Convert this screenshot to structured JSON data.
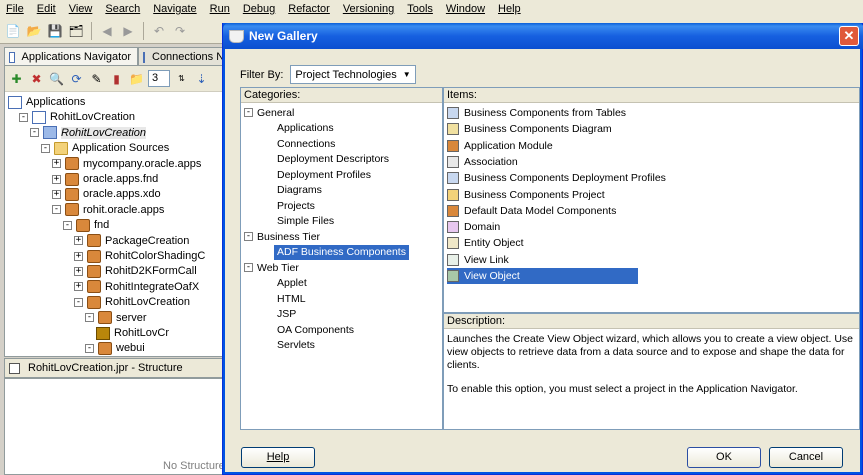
{
  "menu": [
    "File",
    "Edit",
    "View",
    "Search",
    "Navigate",
    "Run",
    "Debug",
    "Refactor",
    "Versioning",
    "Tools",
    "Window",
    "Help"
  ],
  "left": {
    "tabs": [
      "Applications Navigator",
      "Connections N"
    ],
    "spinner_value": "3",
    "tree": [
      {
        "label": "Applications",
        "indent": 0,
        "icon": "app",
        "exp": ""
      },
      {
        "label": "RohitLovCreation",
        "indent": 1,
        "icon": "app",
        "exp": "-"
      },
      {
        "label": "RohitLovCreation",
        "indent": 2,
        "icon": "proj",
        "exp": "-"
      },
      {
        "label": "Application Sources",
        "indent": 3,
        "icon": "folder",
        "exp": "-"
      },
      {
        "label": "mycompany.oracle.apps",
        "indent": 4,
        "icon": "pkg",
        "exp": "+"
      },
      {
        "label": "oracle.apps.fnd",
        "indent": 4,
        "icon": "pkg",
        "exp": "+"
      },
      {
        "label": "oracle.apps.xdo",
        "indent": 4,
        "icon": "pkg",
        "exp": "+"
      },
      {
        "label": "rohit.oracle.apps",
        "indent": 4,
        "icon": "pkg",
        "exp": "-"
      },
      {
        "label": "fnd",
        "indent": 5,
        "icon": "pkg",
        "exp": "-"
      },
      {
        "label": "PackageCreation",
        "indent": 6,
        "icon": "pkg",
        "exp": "+"
      },
      {
        "label": "RohitColorShadingC",
        "indent": 6,
        "icon": "pkg",
        "exp": "+"
      },
      {
        "label": "RohitD2KFormCall",
        "indent": 6,
        "icon": "pkg",
        "exp": "+"
      },
      {
        "label": "RohitIntegrateOafX",
        "indent": 6,
        "icon": "pkg",
        "exp": "+"
      },
      {
        "label": "RohitLovCreation",
        "indent": 6,
        "icon": "pkg",
        "exp": "-"
      },
      {
        "label": "server",
        "indent": 7,
        "icon": "pkg",
        "exp": "-"
      },
      {
        "label": "RohitLovCr",
        "indent": 8,
        "icon": "jar",
        "exp": ""
      },
      {
        "label": "webui",
        "indent": 7,
        "icon": "pkg",
        "exp": "-"
      }
    ],
    "structure_tab": "RohitLovCreation.jpr - Structure",
    "structure_empty": "No Structure"
  },
  "dialog": {
    "title": "New Gallery",
    "filter_label": "Filter By:",
    "filter_value": "Project Technologies",
    "categories_header": "Categories:",
    "categories": [
      {
        "label": "General",
        "level": 0,
        "exp": "-"
      },
      {
        "label": "Applications",
        "level": 1
      },
      {
        "label": "Connections",
        "level": 1
      },
      {
        "label": "Deployment Descriptors",
        "level": 1
      },
      {
        "label": "Deployment Profiles",
        "level": 1
      },
      {
        "label": "Diagrams",
        "level": 1
      },
      {
        "label": "Projects",
        "level": 1
      },
      {
        "label": "Simple Files",
        "level": 1
      },
      {
        "label": "Business Tier",
        "level": 0,
        "exp": "-"
      },
      {
        "label": "ADF Business Components",
        "level": 1,
        "selected": true
      },
      {
        "label": "Web Tier",
        "level": 0,
        "exp": "-"
      },
      {
        "label": "Applet",
        "level": 1
      },
      {
        "label": "HTML",
        "level": 1
      },
      {
        "label": "JSP",
        "level": 1
      },
      {
        "label": "OA Components",
        "level": 1
      },
      {
        "label": "Servlets",
        "level": 1
      }
    ],
    "items_header": "Items:",
    "items": [
      {
        "label": "Business Components from Tables",
        "icon": "bc-tables-icon"
      },
      {
        "label": "Business Components Diagram",
        "icon": "bc-diagram-icon"
      },
      {
        "label": "Application Module",
        "icon": "app-module-icon"
      },
      {
        "label": "Association",
        "icon": "association-icon"
      },
      {
        "label": "Business Components Deployment Profiles",
        "icon": "deploy-profile-icon"
      },
      {
        "label": "Business Components Project",
        "icon": "bc-project-icon"
      },
      {
        "label": "Default Data Model Components",
        "icon": "data-model-icon"
      },
      {
        "label": "Domain",
        "icon": "domain-icon"
      },
      {
        "label": "Entity Object",
        "icon": "entity-object-icon"
      },
      {
        "label": "View Link",
        "icon": "view-link-icon"
      },
      {
        "label": "View Object",
        "icon": "view-object-icon",
        "selected": true
      }
    ],
    "description_header": "Description:",
    "description_p1": "Launches the Create View Object wizard, which allows you to create a view object. Use view objects to retrieve data from a data source and to expose and shape the data for clients.",
    "description_p2": "To enable this option, you must select a project in the Application Navigator.",
    "help_label": "Help",
    "ok_label": "OK",
    "cancel_label": "Cancel"
  }
}
